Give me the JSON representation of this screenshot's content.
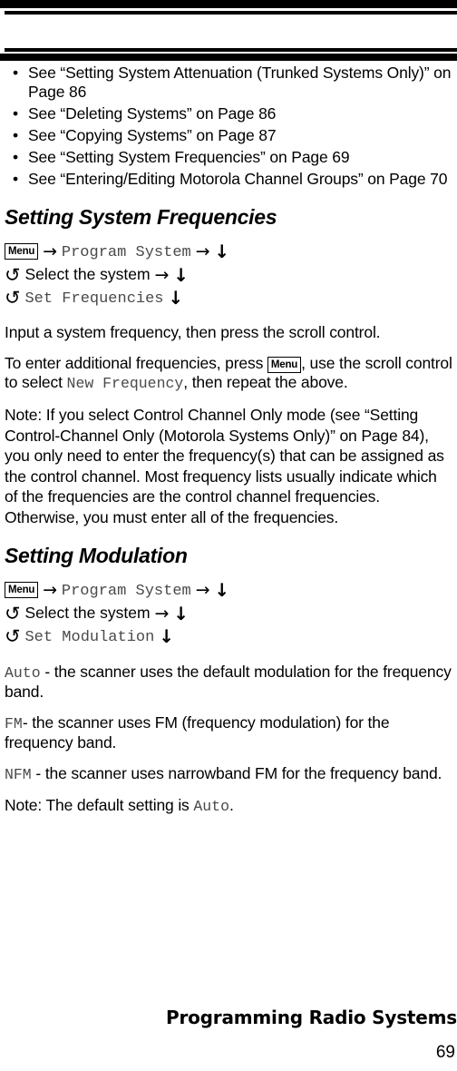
{
  "page": {
    "number": "69",
    "footer_title": "Programming Radio Systems"
  },
  "cross_references": {
    "items": [
      {
        "bullet": "•",
        "text": "See “Setting System Attenuation (Trunked Systems Only)” on Page 86"
      },
      {
        "bullet": "•",
        "text": "See “Deleting Systems” on Page 86"
      },
      {
        "bullet": "•",
        "text": "See “Copying Systems” on Page 87"
      },
      {
        "bullet": "•",
        "text": "See “Setting System Frequencies” on Page 69"
      },
      {
        "bullet": "•",
        "text": "See “Entering/Editing Motorola Channel Groups” on Page 70"
      }
    ]
  },
  "section_frequencies": {
    "title": "Setting System Frequencies",
    "steps": {
      "menu_key": "Menu",
      "arrow_right": "→",
      "arrow_down": "↓",
      "scroll_icon": "↻",
      "step1_menu_item": "Program System",
      "step2_text": "Select the system",
      "step3_menu_item": "Set Frequencies"
    },
    "paragraph_1": "Input a system frequency, then press the scroll control.",
    "paragraph_2": {
      "part_a": "To enter additional frequencies, press ",
      "key": "Menu",
      "part_b": ", use the scroll control to select ",
      "mono": "New Frequency",
      "part_c": ", then repeat the above."
    },
    "note": "Note: If you select Control Channel Only mode (see “Setting Control-Channel Only (Motorola Systems Only)” on Page 84), you only need to enter the frequency(s) that can be assigned as the control channel. Most frequency lists usually indicate which of the frequencies are the control channel frequencies. Otherwise, you must enter all of the frequencies."
  },
  "section_modulation": {
    "title": "Setting Modulation",
    "steps": {
      "menu_key": "Menu",
      "arrow_right": "→",
      "arrow_down": "↓",
      "scroll_icon": "↻",
      "step1_menu_item": "Program System",
      "step2_text": "Select the system",
      "step3_menu_item": "Set Modulation"
    },
    "options": [
      {
        "value": "Auto",
        "description": " - the scanner uses the default modulation for the frequency band."
      },
      {
        "value": "FM",
        "description": "- the scanner uses FM (frequency modulation) for the frequency band."
      },
      {
        "value": "NFM",
        "description": " - the scanner uses narrowband FM for the frequency band."
      }
    ],
    "note_prefix": "Note: The default setting is ",
    "note_value": "Auto",
    "note_suffix": "."
  }
}
